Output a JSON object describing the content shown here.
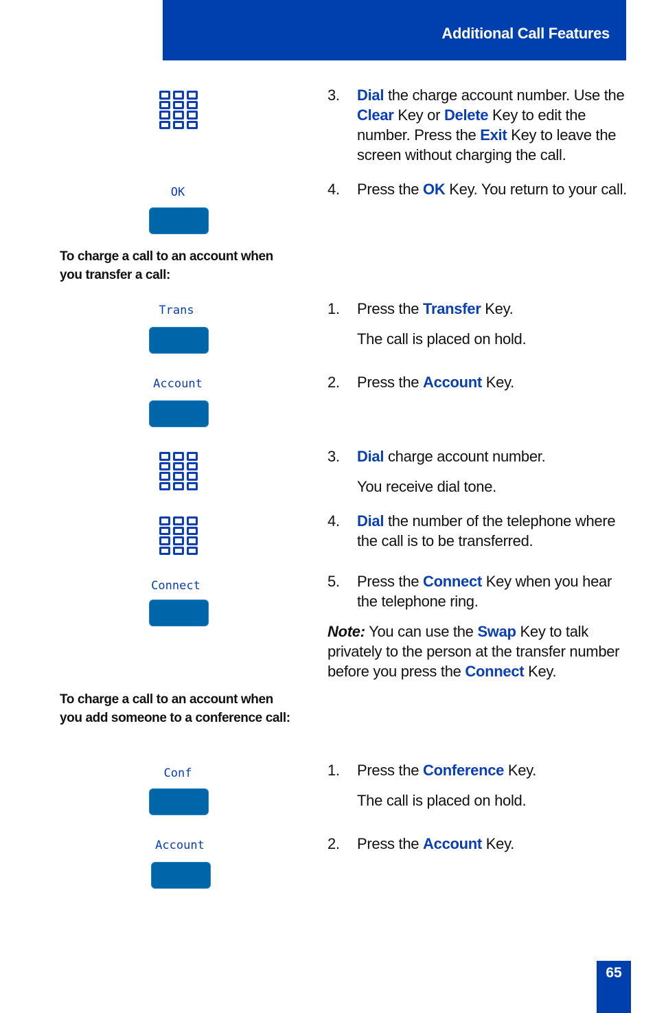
{
  "header": {
    "title": "Additional Call Features"
  },
  "page_number": "65",
  "colors": {
    "brand_blue": "#0040ae",
    "keyword_blue": "#0a3fb3",
    "softkey_blue": "#0066aa"
  },
  "softkeys": [
    {
      "label": "OK",
      "icon": "softkey-button"
    },
    {
      "label": "Trans",
      "icon": "softkey-button"
    },
    {
      "label": "Account",
      "icon": "softkey-button"
    },
    {
      "label": "Connect",
      "icon": "softkey-button"
    },
    {
      "label": "Conf",
      "icon": "softkey-button"
    },
    {
      "label": "Account",
      "icon": "softkey-button"
    }
  ],
  "keypad_icon": "dialpad-icon",
  "sections": [
    {
      "heading": "",
      "steps": [
        {
          "num": "3.",
          "parts": [
            {
              "t": "Dial",
              "kw": true
            },
            {
              "t": " the charge account number. Use the "
            },
            {
              "t": "Clear",
              "kw": true
            },
            {
              "t": " Key or "
            },
            {
              "t": "Delete",
              "kw": true
            },
            {
              "t": " Key to edit the number. Press the "
            },
            {
              "t": "Exit",
              "kw": true
            },
            {
              "t": " Key to leave the screen without charging the call."
            }
          ]
        },
        {
          "num": "4.",
          "parts": [
            {
              "t": "Press the "
            },
            {
              "t": "OK",
              "kw": true
            },
            {
              "t": " Key. You return to your call."
            }
          ]
        }
      ]
    },
    {
      "heading": "To charge a call to an account when you transfer a call:",
      "steps": [
        {
          "num": "1.",
          "parts": [
            {
              "t": "Press the "
            },
            {
              "t": "Transfer",
              "kw": true
            },
            {
              "t": " Key."
            }
          ],
          "sub": "The call is placed on hold."
        },
        {
          "num": "2.",
          "parts": [
            {
              "t": "Press the "
            },
            {
              "t": "Account",
              "kw": true
            },
            {
              "t": " Key."
            }
          ]
        },
        {
          "num": "3.",
          "parts": [
            {
              "t": "Dial",
              "kw": true
            },
            {
              "t": " charge account number."
            }
          ],
          "sub": "You receive dial tone."
        },
        {
          "num": "4.",
          "parts": [
            {
              "t": "Dial",
              "kw": true
            },
            {
              "t": " the number of the telephone where the call is to be transferred."
            }
          ]
        },
        {
          "num": "5.",
          "parts": [
            {
              "t": "Press the "
            },
            {
              "t": "Connect",
              "kw": true
            },
            {
              "t": " Key when you hear the telephone ring."
            }
          ]
        }
      ],
      "note": {
        "label": "Note:",
        "parts": [
          {
            "t": " You can use the "
          },
          {
            "t": "Swap",
            "kw": true
          },
          {
            "t": " Key to talk privately to the person at the transfer number before you press the "
          },
          {
            "t": "Connect",
            "kw": true
          },
          {
            "t": " Key."
          }
        ]
      }
    },
    {
      "heading": "To charge a call to an account when you add someone to a conference call:",
      "steps": [
        {
          "num": "1.",
          "parts": [
            {
              "t": "Press the "
            },
            {
              "t": "Conference",
              "kw": true
            },
            {
              "t": " Key."
            }
          ],
          "sub": "The call is placed on hold."
        },
        {
          "num": "2.",
          "parts": [
            {
              "t": "Press the "
            },
            {
              "t": "Account",
              "kw": true
            },
            {
              "t": " Key."
            }
          ]
        }
      ]
    }
  ]
}
